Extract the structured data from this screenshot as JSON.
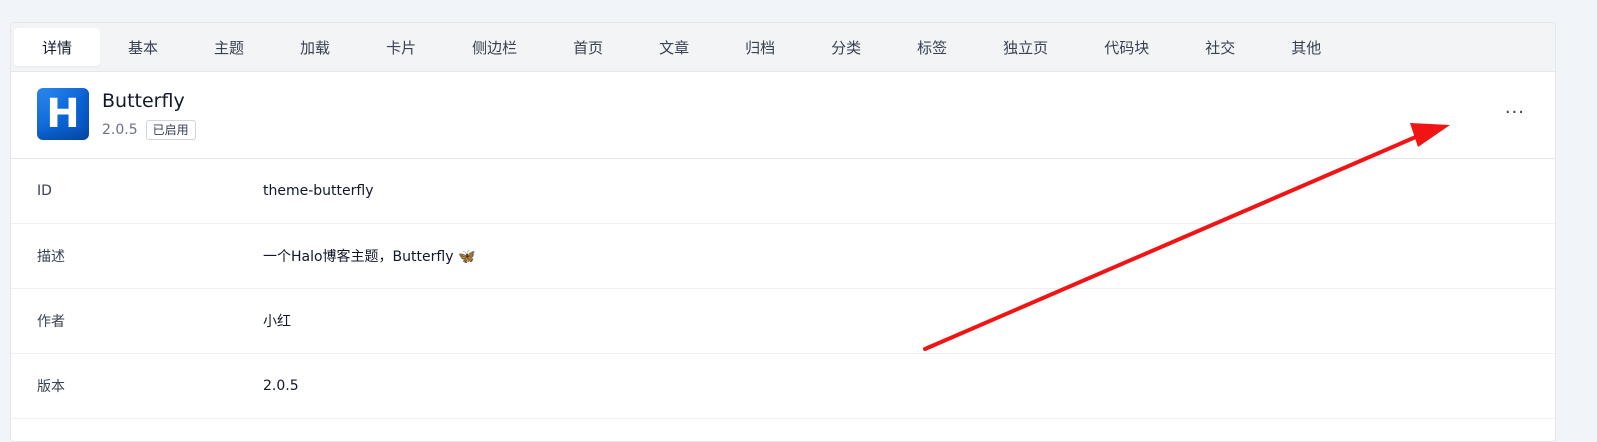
{
  "tabs": [
    {
      "label": "详情",
      "active": true
    },
    {
      "label": "基本"
    },
    {
      "label": "主题"
    },
    {
      "label": "加载"
    },
    {
      "label": "卡片"
    },
    {
      "label": "侧边栏"
    },
    {
      "label": "首页"
    },
    {
      "label": "文章"
    },
    {
      "label": "归档"
    },
    {
      "label": "分类"
    },
    {
      "label": "标签"
    },
    {
      "label": "独立页"
    },
    {
      "label": "代码块"
    },
    {
      "label": "社交"
    },
    {
      "label": "其他"
    }
  ],
  "theme": {
    "logo_letter": "H",
    "name": "Butterfly",
    "version": "2.0.5",
    "status": "已启用",
    "more_label": "···"
  },
  "details": {
    "rows": [
      {
        "label": "ID",
        "value": "theme-butterfly"
      },
      {
        "label": "描述",
        "value": "一个Halo博客主题，Butterfly 🦋"
      },
      {
        "label": "作者",
        "value": "小红"
      },
      {
        "label": "版本",
        "value": "2.0.5"
      }
    ]
  },
  "colors": {
    "accent_arrow": "#f01414",
    "logo_blue": "#0a63d6"
  }
}
